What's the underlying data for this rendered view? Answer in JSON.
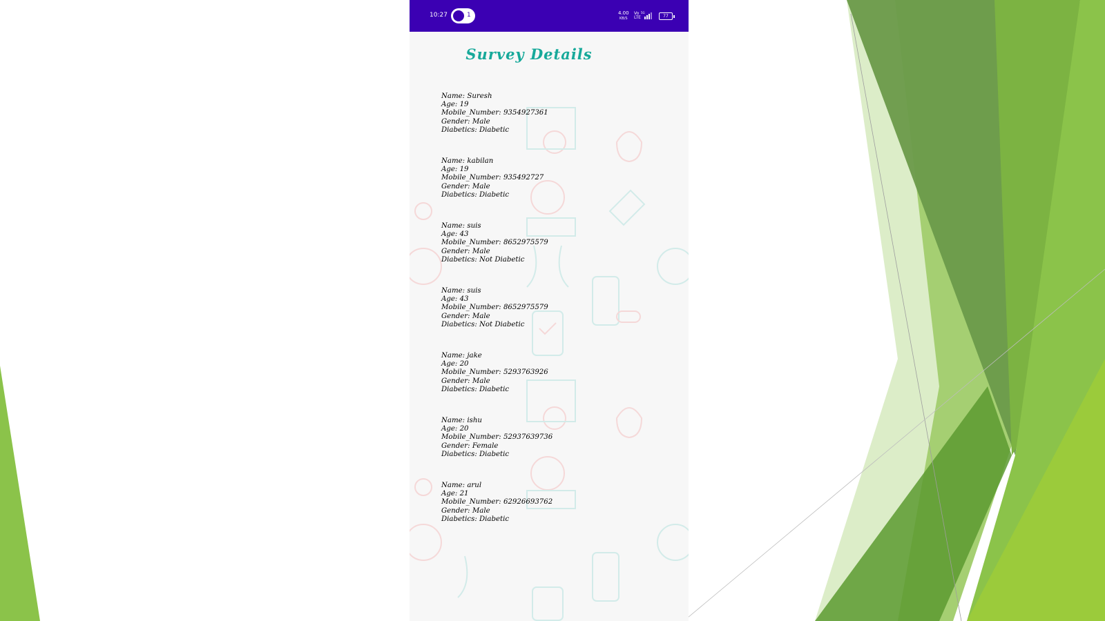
{
  "colors": {
    "status_bar": "#3b00b3",
    "title": "#17a99a",
    "green_dark": "#6a9a4a",
    "green_mid": "#7cb342",
    "green_light": "#8bc34a",
    "green_pale": "#dcedc8"
  },
  "status_bar": {
    "time": "10:27",
    "notification_count": "1",
    "speed": "4.00",
    "speed_unit": "KB/S",
    "network_top": "Vo",
    "network_bottom": "LTE",
    "network_type": "5G",
    "battery": "77"
  },
  "title": "Survey Details",
  "records": [
    {
      "name": "Name: Suresh",
      "age": "Age: 19",
      "mobile": "Mobile_Number: 9354927361",
      "gender": "Gender: Male",
      "diabetics": "Diabetics: Diabetic"
    },
    {
      "name": "Name: kabilan",
      "age": "Age: 19",
      "mobile": "Mobile_Number: 935492727",
      "gender": "Gender: Male",
      "diabetics": "Diabetics: Diabetic"
    },
    {
      "name": "Name: suis",
      "age": "Age: 43",
      "mobile": "Mobile_Number: 8652975579",
      "gender": "Gender: Male",
      "diabetics": "Diabetics: Not Diabetic"
    },
    {
      "name": "Name: suis",
      "age": "Age: 43",
      "mobile": "Mobile_Number: 8652975579",
      "gender": "Gender: Male",
      "diabetics": "Diabetics: Not Diabetic"
    },
    {
      "name": "Name: jake",
      "age": "Age: 20",
      "mobile": "Mobile_Number: 5293763926",
      "gender": "Gender: Male",
      "diabetics": "Diabetics: Diabetic"
    },
    {
      "name": "Name: ishu",
      "age": "Age: 20",
      "mobile": "Mobile_Number: 52937639736",
      "gender": "Gender: Female",
      "diabetics": "Diabetics: Diabetic"
    },
    {
      "name": "Name: arul",
      "age": "Age: 21",
      "mobile": "Mobile_Number: 62926693762",
      "gender": "Gender: Male",
      "diabetics": "Diabetics: Diabetic"
    }
  ]
}
